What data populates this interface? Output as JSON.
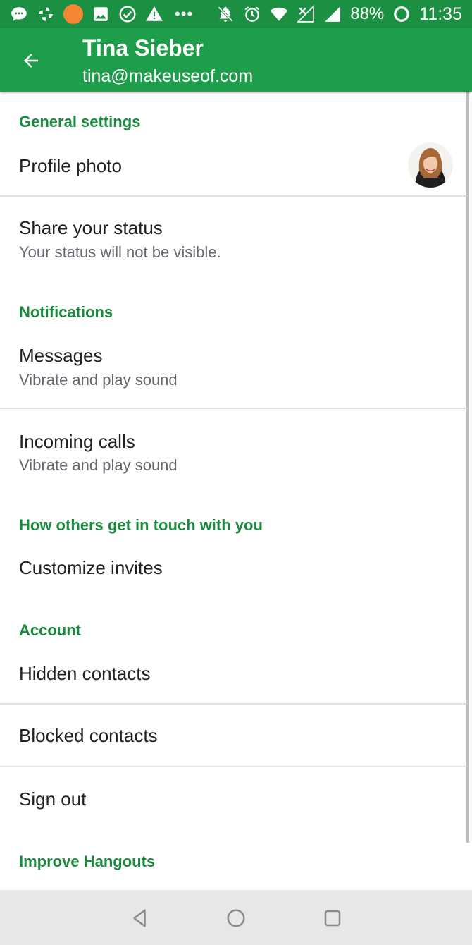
{
  "status_bar": {
    "left_icons": [
      "message-bubble-icon",
      "pinwheel-icon",
      "orange-dot-icon",
      "image-icon",
      "check-circle-icon",
      "warning-icon",
      "more-dots-icon"
    ],
    "more_dots": "•••",
    "right_icons": [
      "notifications-off-icon",
      "alarm-icon",
      "wifi-icon",
      "no-data-signal-icon",
      "signal-icon",
      "battery-icon"
    ],
    "battery": "88%",
    "time": "11:35"
  },
  "app_bar": {
    "back_icon": "arrow-back-icon",
    "title": "Tina Sieber",
    "subtitle": "tina@makeuseof.com",
    "background": "#1e9e4a"
  },
  "sections": {
    "general": {
      "header": "General settings",
      "profile_photo": "Profile photo",
      "share_status": {
        "title": "Share your status",
        "subtitle": "Your status will not be visible."
      }
    },
    "notifications": {
      "header": "Notifications",
      "messages": {
        "title": "Messages",
        "subtitle": "Vibrate and play sound"
      },
      "incoming_calls": {
        "title": "Incoming calls",
        "subtitle": "Vibrate and play sound"
      }
    },
    "touch": {
      "header": "How others get in touch with you",
      "customize_invites": "Customize invites"
    },
    "account": {
      "header": "Account",
      "hidden_contacts": "Hidden contacts",
      "blocked_contacts": "Blocked contacts",
      "sign_out": "Sign out"
    },
    "improve": {
      "header": "Improve Hangouts"
    }
  },
  "nav_bar": {
    "back_icon": "nav-back-triangle-icon",
    "home_icon": "nav-home-circle-icon",
    "recents_icon": "nav-recents-square-icon"
  },
  "colors": {
    "accent": "#1b8a3e",
    "status_bar": "#1b8f42",
    "orange_notification": "#f58634"
  }
}
